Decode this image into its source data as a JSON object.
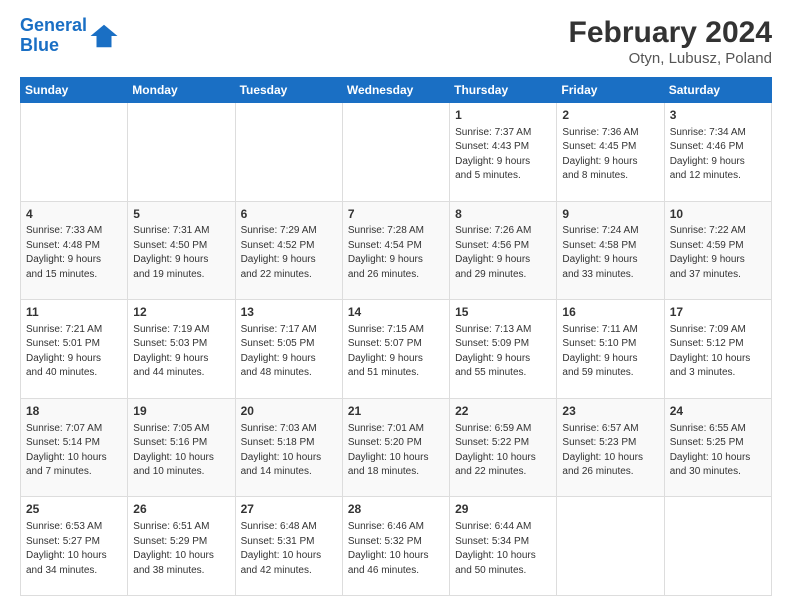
{
  "logo": {
    "line1": "General",
    "line2": "Blue"
  },
  "title": "February 2024",
  "subtitle": "Otyn, Lubusz, Poland",
  "days_of_week": [
    "Sunday",
    "Monday",
    "Tuesday",
    "Wednesday",
    "Thursday",
    "Friday",
    "Saturday"
  ],
  "weeks": [
    [
      {
        "day": "",
        "info": ""
      },
      {
        "day": "",
        "info": ""
      },
      {
        "day": "",
        "info": ""
      },
      {
        "day": "",
        "info": ""
      },
      {
        "day": "1",
        "info": "Sunrise: 7:37 AM\nSunset: 4:43 PM\nDaylight: 9 hours\nand 5 minutes."
      },
      {
        "day": "2",
        "info": "Sunrise: 7:36 AM\nSunset: 4:45 PM\nDaylight: 9 hours\nand 8 minutes."
      },
      {
        "day": "3",
        "info": "Sunrise: 7:34 AM\nSunset: 4:46 PM\nDaylight: 9 hours\nand 12 minutes."
      }
    ],
    [
      {
        "day": "4",
        "info": "Sunrise: 7:33 AM\nSunset: 4:48 PM\nDaylight: 9 hours\nand 15 minutes."
      },
      {
        "day": "5",
        "info": "Sunrise: 7:31 AM\nSunset: 4:50 PM\nDaylight: 9 hours\nand 19 minutes."
      },
      {
        "day": "6",
        "info": "Sunrise: 7:29 AM\nSunset: 4:52 PM\nDaylight: 9 hours\nand 22 minutes."
      },
      {
        "day": "7",
        "info": "Sunrise: 7:28 AM\nSunset: 4:54 PM\nDaylight: 9 hours\nand 26 minutes."
      },
      {
        "day": "8",
        "info": "Sunrise: 7:26 AM\nSunset: 4:56 PM\nDaylight: 9 hours\nand 29 minutes."
      },
      {
        "day": "9",
        "info": "Sunrise: 7:24 AM\nSunset: 4:58 PM\nDaylight: 9 hours\nand 33 minutes."
      },
      {
        "day": "10",
        "info": "Sunrise: 7:22 AM\nSunset: 4:59 PM\nDaylight: 9 hours\nand 37 minutes."
      }
    ],
    [
      {
        "day": "11",
        "info": "Sunrise: 7:21 AM\nSunset: 5:01 PM\nDaylight: 9 hours\nand 40 minutes."
      },
      {
        "day": "12",
        "info": "Sunrise: 7:19 AM\nSunset: 5:03 PM\nDaylight: 9 hours\nand 44 minutes."
      },
      {
        "day": "13",
        "info": "Sunrise: 7:17 AM\nSunset: 5:05 PM\nDaylight: 9 hours\nand 48 minutes."
      },
      {
        "day": "14",
        "info": "Sunrise: 7:15 AM\nSunset: 5:07 PM\nDaylight: 9 hours\nand 51 minutes."
      },
      {
        "day": "15",
        "info": "Sunrise: 7:13 AM\nSunset: 5:09 PM\nDaylight: 9 hours\nand 55 minutes."
      },
      {
        "day": "16",
        "info": "Sunrise: 7:11 AM\nSunset: 5:10 PM\nDaylight: 9 hours\nand 59 minutes."
      },
      {
        "day": "17",
        "info": "Sunrise: 7:09 AM\nSunset: 5:12 PM\nDaylight: 10 hours\nand 3 minutes."
      }
    ],
    [
      {
        "day": "18",
        "info": "Sunrise: 7:07 AM\nSunset: 5:14 PM\nDaylight: 10 hours\nand 7 minutes."
      },
      {
        "day": "19",
        "info": "Sunrise: 7:05 AM\nSunset: 5:16 PM\nDaylight: 10 hours\nand 10 minutes."
      },
      {
        "day": "20",
        "info": "Sunrise: 7:03 AM\nSunset: 5:18 PM\nDaylight: 10 hours\nand 14 minutes."
      },
      {
        "day": "21",
        "info": "Sunrise: 7:01 AM\nSunset: 5:20 PM\nDaylight: 10 hours\nand 18 minutes."
      },
      {
        "day": "22",
        "info": "Sunrise: 6:59 AM\nSunset: 5:22 PM\nDaylight: 10 hours\nand 22 minutes."
      },
      {
        "day": "23",
        "info": "Sunrise: 6:57 AM\nSunset: 5:23 PM\nDaylight: 10 hours\nand 26 minutes."
      },
      {
        "day": "24",
        "info": "Sunrise: 6:55 AM\nSunset: 5:25 PM\nDaylight: 10 hours\nand 30 minutes."
      }
    ],
    [
      {
        "day": "25",
        "info": "Sunrise: 6:53 AM\nSunset: 5:27 PM\nDaylight: 10 hours\nand 34 minutes."
      },
      {
        "day": "26",
        "info": "Sunrise: 6:51 AM\nSunset: 5:29 PM\nDaylight: 10 hours\nand 38 minutes."
      },
      {
        "day": "27",
        "info": "Sunrise: 6:48 AM\nSunset: 5:31 PM\nDaylight: 10 hours\nand 42 minutes."
      },
      {
        "day": "28",
        "info": "Sunrise: 6:46 AM\nSunset: 5:32 PM\nDaylight: 10 hours\nand 46 minutes."
      },
      {
        "day": "29",
        "info": "Sunrise: 6:44 AM\nSunset: 5:34 PM\nDaylight: 10 hours\nand 50 minutes."
      },
      {
        "day": "",
        "info": ""
      },
      {
        "day": "",
        "info": ""
      }
    ]
  ]
}
